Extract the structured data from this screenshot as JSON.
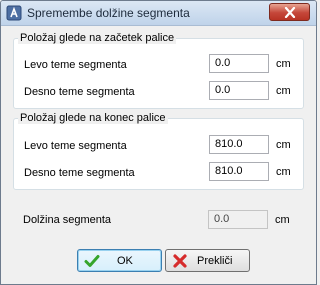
{
  "window": {
    "title": "Spremembe dolžine segmenta",
    "close_label": ""
  },
  "group_start": {
    "title": "Položaj glede na začetek palice",
    "left_label": "Levo teme segmenta",
    "left_value": "0.0",
    "right_label": "Desno teme segmenta",
    "right_value": "0.0"
  },
  "group_end": {
    "title": "Položaj glede na konec palice",
    "left_label": "Levo teme segmenta",
    "left_value": "810.0",
    "right_label": "Desno teme segmenta",
    "right_value": "810.0"
  },
  "length": {
    "label": "Dolžina segmenta",
    "value": "0.0"
  },
  "unit": "cm",
  "buttons": {
    "ok_label": "OK",
    "cancel_label": "Prekliči"
  },
  "colors": {
    "accent": "#3c7fb1",
    "close": "#c5473a",
    "ok_check": "#36a52b",
    "cancel_x": "#d62b2b"
  },
  "icons": {
    "app": "app-icon",
    "close": "close-icon",
    "ok": "check-icon",
    "cancel": "cross-icon"
  }
}
